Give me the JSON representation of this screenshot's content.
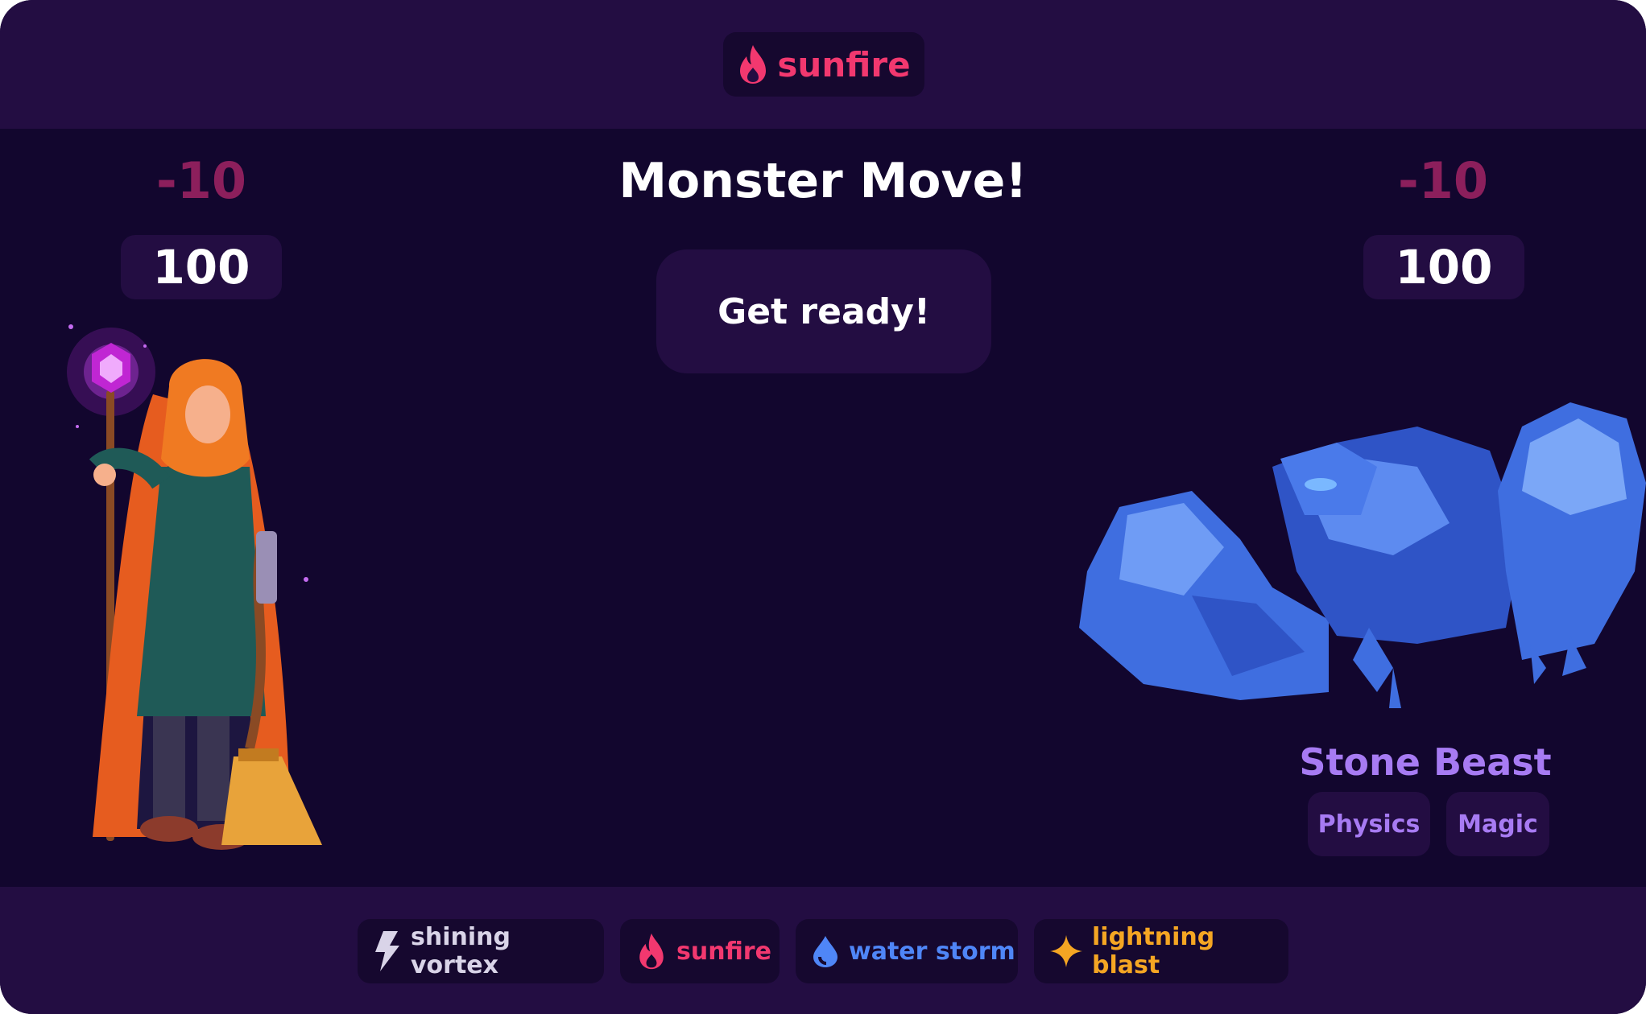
{
  "current_spell": {
    "label": "sunfire",
    "icon": "flame-icon",
    "color": "#f2386f"
  },
  "player": {
    "damage_delta": "-10",
    "hp": "100",
    "character": "wizard-with-staff-and-broom"
  },
  "opponent": {
    "damage_delta": "-10",
    "hp": "100",
    "name": "Stone Beast",
    "tags": [
      "Physics",
      "Magic"
    ],
    "character": "blue-crystal-golem"
  },
  "headline": "Monster Move!",
  "action_button": "Get ready!",
  "spells": [
    {
      "label": "shining vortex",
      "icon": "bolt-icon",
      "color": "#d9d4e8"
    },
    {
      "label": "sunfire",
      "icon": "flame-icon",
      "color": "#f2386f"
    },
    {
      "label": "water storm",
      "icon": "droplet-icon",
      "color": "#4f86f7"
    },
    {
      "label": "lightning blast",
      "icon": "sparkle-icon",
      "color": "#f5a623"
    }
  ],
  "colors": {
    "background": "#12062e",
    "panel": "#230d42",
    "chip": "#16082f",
    "accent_pink": "#f2386f",
    "damage": "#8c1f5c",
    "monster_text": "#a77bf3"
  }
}
